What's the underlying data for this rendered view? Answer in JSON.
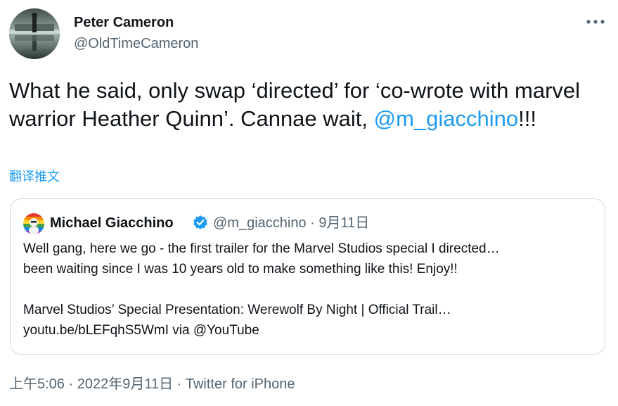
{
  "author": {
    "name": "Peter Cameron",
    "handle": "@OldTimeCameron"
  },
  "tweet": {
    "text_part1": "What he said, only swap ‘directed’ for ‘co-wrote with marvel warrior Heather Quinn’. Cannae wait, ",
    "mention": "@m_giacchino",
    "text_part2": "!!!",
    "translate_label": "翻译推文"
  },
  "quoted_tweet": {
    "author_name": "Michael Giacchino",
    "handle_and_date": "@m_giacchino · 9月11日",
    "lines": [
      "Well gang, here we go - the first trailer for the Marvel Studios special I directed…",
      "been waiting since I was 10 years old to make something like this! Enjoy!!",
      "Marvel Studios’ Special Presentation: Werewolf By Night | Official Trail…",
      "youtu.be/bLEFqhS5WmI via @YouTube"
    ]
  },
  "footer": {
    "time_date": "上午5:06 · 2022年9月11日 · ",
    "source": "Twitter for iPhone"
  },
  "colors": {
    "link": "#1d9bf0",
    "secondary_text": "#536471",
    "border": "#cfd9de",
    "verified": "#1d9bf0"
  },
  "icons": {
    "more": "more-icon",
    "verified": "verified-badge-icon"
  }
}
